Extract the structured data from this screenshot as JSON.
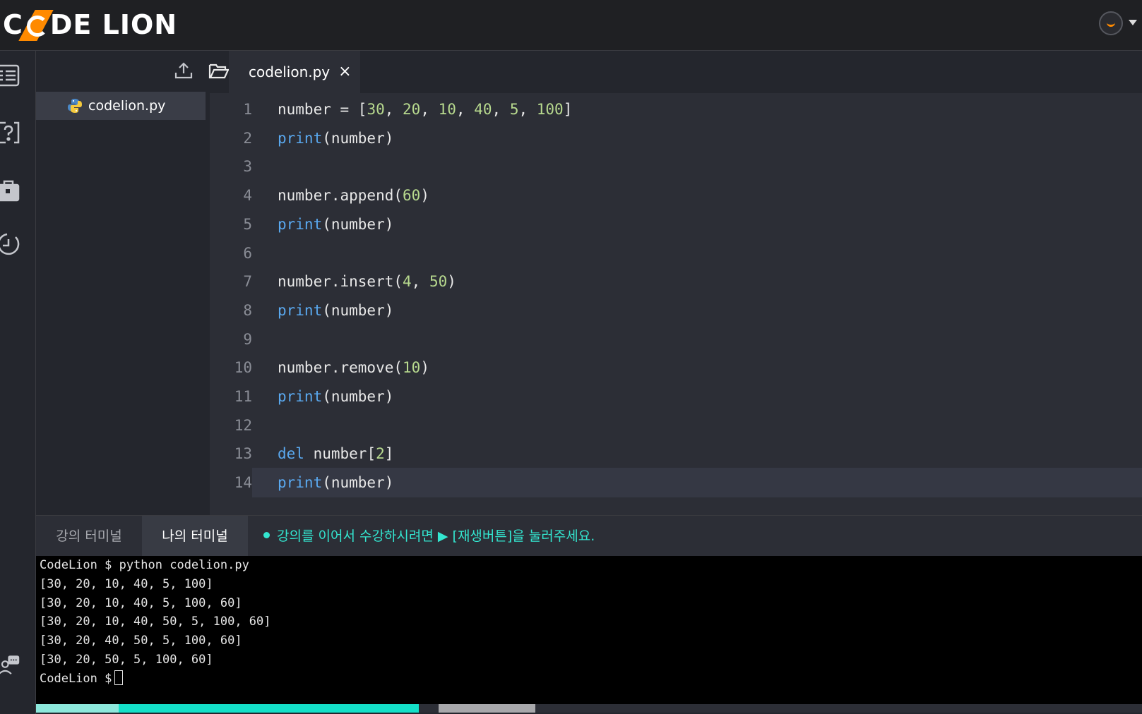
{
  "header": {
    "logo_left": "C",
    "logo_right": "DE LION",
    "brand_color": "#ff8a00"
  },
  "rail": {
    "icons": [
      "list-icon",
      "question-icon",
      "briefcase-icon",
      "history-icon",
      "chat-user-icon"
    ]
  },
  "file_panel": {
    "upload_icon": "upload-icon",
    "files": [
      {
        "name": "codelion.py",
        "icon": "python-icon"
      }
    ]
  },
  "tabs": {
    "folder_icon": "folder-open-icon",
    "active": {
      "label": "codelion.py",
      "close": "×"
    }
  },
  "editor": {
    "current_line": 14,
    "lines": [
      {
        "n": "1",
        "tokens": [
          {
            "t": "number = [",
            "c": ""
          },
          {
            "t": "30",
            "c": "num"
          },
          {
            "t": ", ",
            "c": ""
          },
          {
            "t": "20",
            "c": "num"
          },
          {
            "t": ", ",
            "c": ""
          },
          {
            "t": "10",
            "c": "num"
          },
          {
            "t": ", ",
            "c": ""
          },
          {
            "t": "40",
            "c": "num"
          },
          {
            "t": ", ",
            "c": ""
          },
          {
            "t": "5",
            "c": "num"
          },
          {
            "t": ", ",
            "c": ""
          },
          {
            "t": "100",
            "c": "num"
          },
          {
            "t": "]",
            "c": ""
          }
        ]
      },
      {
        "n": "2",
        "tokens": [
          {
            "t": "print",
            "c": "kw"
          },
          {
            "t": "(number)",
            "c": ""
          }
        ]
      },
      {
        "n": "3",
        "tokens": []
      },
      {
        "n": "4",
        "tokens": [
          {
            "t": "number.append(",
            "c": ""
          },
          {
            "t": "60",
            "c": "num"
          },
          {
            "t": ")",
            "c": ""
          }
        ]
      },
      {
        "n": "5",
        "tokens": [
          {
            "t": "print",
            "c": "kw"
          },
          {
            "t": "(number)",
            "c": ""
          }
        ]
      },
      {
        "n": "6",
        "tokens": []
      },
      {
        "n": "7",
        "tokens": [
          {
            "t": "number.insert(",
            "c": ""
          },
          {
            "t": "4",
            "c": "num"
          },
          {
            "t": ", ",
            "c": ""
          },
          {
            "t": "50",
            "c": "num"
          },
          {
            "t": ")",
            "c": ""
          }
        ]
      },
      {
        "n": "8",
        "tokens": [
          {
            "t": "print",
            "c": "kw"
          },
          {
            "t": "(number)",
            "c": ""
          }
        ]
      },
      {
        "n": "9",
        "tokens": []
      },
      {
        "n": "10",
        "tokens": [
          {
            "t": "number.remove(",
            "c": ""
          },
          {
            "t": "10",
            "c": "num"
          },
          {
            "t": ")",
            "c": ""
          }
        ]
      },
      {
        "n": "11",
        "tokens": [
          {
            "t": "print",
            "c": "kw"
          },
          {
            "t": "(number)",
            "c": ""
          }
        ]
      },
      {
        "n": "12",
        "tokens": []
      },
      {
        "n": "13",
        "tokens": [
          {
            "t": "del",
            "c": "kw"
          },
          {
            "t": " number[",
            "c": ""
          },
          {
            "t": "2",
            "c": "num"
          },
          {
            "t": "]",
            "c": ""
          }
        ]
      },
      {
        "n": "14",
        "tokens": [
          {
            "t": "print",
            "c": "kw"
          },
          {
            "t": "(number)",
            "c": ""
          }
        ]
      }
    ]
  },
  "terminal_bar": {
    "tab_lecture": "강의 터미널",
    "tab_mine": "나의 터미널",
    "notice": "강의를 이어서 수강하시려면  ▶ [재생버튼]을 눌러주세요."
  },
  "terminal": {
    "lines": [
      "CodeLion $ python codelion.py",
      "[30, 20, 10, 40, 5, 100]",
      "[30, 20, 10, 40, 5, 100, 60]",
      "[30, 20, 10, 40, 50, 5, 100, 60]",
      "[30, 20, 40, 50, 5, 100, 60]",
      "[30, 20, 50, 5, 100, 60]"
    ],
    "prompt": "CodeLion $"
  },
  "colors": {
    "accent": "#33e6d0",
    "keyword": "#5aa9f0",
    "number": "#b7d98e"
  }
}
